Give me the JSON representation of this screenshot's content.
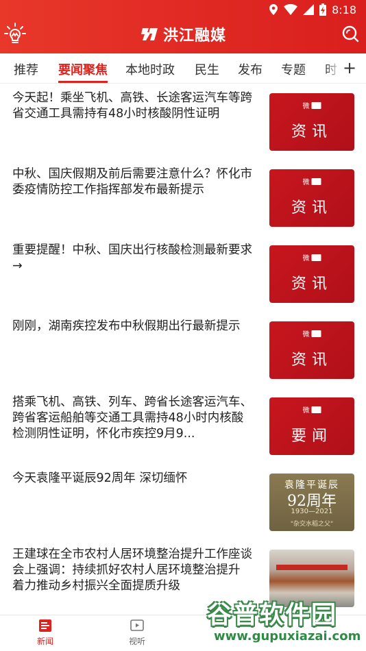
{
  "status_bar": {
    "time": "8:18"
  },
  "header": {
    "title": "洪江融媒"
  },
  "tabs": [
    {
      "label": "推荐",
      "active": false
    },
    {
      "label": "要闻聚焦",
      "active": true
    },
    {
      "label": "本地时政",
      "active": false
    },
    {
      "label": "民生",
      "active": false
    },
    {
      "label": "发布",
      "active": false
    },
    {
      "label": "专题",
      "active": false
    },
    {
      "label": "时",
      "active": false
    }
  ],
  "tab_add_label": "+",
  "news": [
    {
      "title": "今天起！乘坐飞机、高铁、长途客运汽车等跨省交通工具需持有48小时核酸阴性证明",
      "thumb_type": "red",
      "thumb_label": "资讯"
    },
    {
      "title": "中秋、国庆假期及前后需要注意什么？怀化市委疫情防控工作指挥部发布最新提示",
      "thumb_type": "red",
      "thumb_label": "资讯"
    },
    {
      "title": "重要提醒！中秋、国庆出行核酸检测最新要求→",
      "thumb_type": "red",
      "thumb_label": "资讯"
    },
    {
      "title": "刚刚，湖南疾控发布中秋假期出行最新提示",
      "thumb_type": "red",
      "thumb_label": "资讯"
    },
    {
      "title": "搭乘飞机、高铁、列车、跨省长途客运汽车、跨省客运船舶等交通工具需持48小时内核酸检测阴性证明，怀化市疾控9月9...",
      "thumb_type": "red",
      "thumb_label": "要闻"
    },
    {
      "title": "今天袁隆平诞辰92周年 深切缅怀",
      "thumb_type": "memorial",
      "thumb_label": ""
    },
    {
      "title": "王建球在全市农村人居环境整治提升工作座谈会上强调：持续抓好农村人居环境整治提升 着力推动乡村振兴全面提质升级",
      "thumb_type": "photo",
      "thumb_label": ""
    }
  ],
  "memorial_thumb": {
    "line1": "袁隆平诞辰",
    "line2": "92周年",
    "line3": "1930—2021",
    "line4": "\"杂交水稻之父\""
  },
  "bottom_nav": [
    {
      "label": "新闻",
      "active": true,
      "icon": "news-icon"
    },
    {
      "label": "视听",
      "active": false,
      "icon": "video-icon"
    }
  ],
  "watermark": {
    "text": "谷普软件园",
    "url": "www.gupuxiazai.com"
  },
  "colors": {
    "brand_red": "#d9241f",
    "header_red": "#e12a24"
  }
}
